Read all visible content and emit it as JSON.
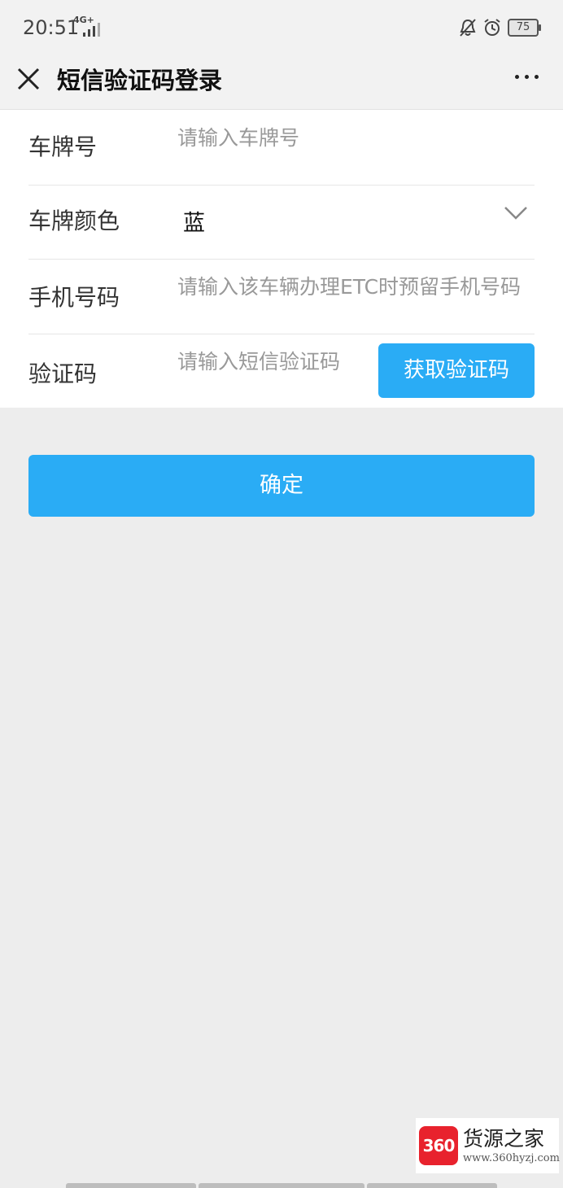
{
  "status_bar": {
    "time": "20:51",
    "network": "4G+",
    "battery": "75"
  },
  "navbar": {
    "title": "短信验证码登录"
  },
  "form": {
    "plate_number": {
      "label": "车牌号",
      "placeholder": "请输入车牌号"
    },
    "plate_color": {
      "label": "车牌颜色",
      "value": "蓝"
    },
    "phone": {
      "label": "手机号码",
      "placeholder": "请输入该车辆办理ETC时预留手机号码"
    },
    "code": {
      "label": "验证码",
      "placeholder": "请输入短信验证码",
      "button_label": "获取验证码"
    }
  },
  "confirm_label": "确定",
  "watermark": {
    "logo_text": "360",
    "name": "货源之家",
    "url": "www.360hyzj.com"
  },
  "colors": {
    "accent": "#2aacf5",
    "background": "#ededed"
  }
}
